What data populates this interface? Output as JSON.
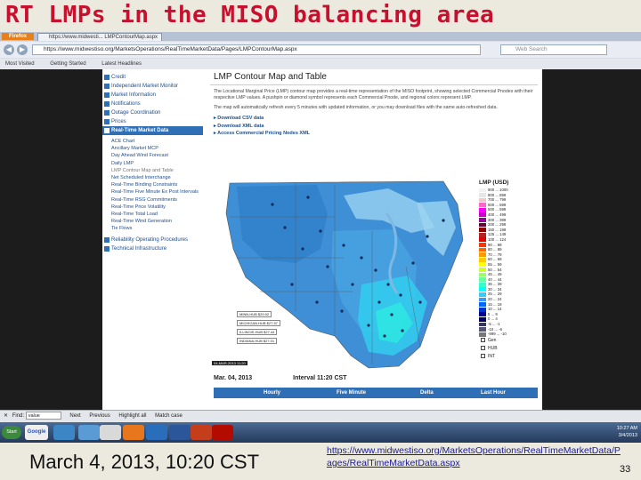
{
  "slide": {
    "title": "RT LMPs in the MISO balancing area",
    "caption": "March 4, 2013, 10:20 CST",
    "source_url": "https://www.midwestiso.org/MarketsOperations/RealTimeMarketData/Pages/RealTimeMarketData.aspx",
    "page_number": "33"
  },
  "browser": {
    "app_button": "Firefox",
    "tab_title": "https://www.midwesti... LMPContourMap.aspx",
    "url": "https://www.midwestiso.org/MarketsOperations/RealTimeMarketData/Pages/LMPContourMap.aspx",
    "search_placeholder": "Web Search",
    "bookmarks": [
      "Most Visited",
      "Getting Started",
      "Latest Headlines"
    ]
  },
  "leftnav": {
    "items": [
      {
        "label": "Credit"
      },
      {
        "label": "Independent Market Monitor"
      },
      {
        "label": "Market Information"
      },
      {
        "label": "Notifications"
      },
      {
        "label": "Outage Coordination"
      },
      {
        "label": "Prices"
      },
      {
        "label": "Real-Time Market Data",
        "active": true
      }
    ],
    "subitems": [
      "ACE Chart",
      "Ancillary Market MCP",
      "Day Ahead Wind Forecast",
      "Daily LMP",
      "LMP Contour Map and Table",
      "Net Scheduled Interchange",
      "Real-Time Binding Constraints",
      "Real-Time Five Minute Ex Post Intervals",
      "Real-Time RSG Commitments",
      "Real-Time Price Volatility",
      "Real-Time Total Load",
      "Real-Time Wind Generation",
      "Tie Flows"
    ],
    "bottom_items": [
      {
        "label": "Reliability Operating Procedures"
      },
      {
        "label": "Technical Infrastructure"
      }
    ]
  },
  "content": {
    "title": "LMP Contour Map and Table",
    "desc1": "The Locational Marginal Price (LMP) contour map provides a real-time representation of the MISO footprint, showing selected Commercial Pnodes with their respective LMP values. A pushpin or diamond symbol represents each Commercial Pnode, and regional colors represent LMP.",
    "desc2": "The map will automatically refresh every 5 minutes with updated information, or you may download files with the same auto-refreshed data.",
    "links": [
      "Download CSV data",
      "Download XML data",
      "Access Commercial Pricing Nodes XML"
    ],
    "map_stamp": "04-MAR-2013 11:20",
    "hub_labels": [
      "MINN.HUB $29.92",
      "MICHIGAN.HUB $27.57",
      "ILLINOIS.HUB $27.44",
      "INDIANA.HUB $27.01"
    ],
    "date_text": "Mar. 04, 2013",
    "interval_text": "Interval 11:20 CST",
    "table_headers": [
      "Hourly",
      "Five Minute",
      "Delta",
      "Last Hour"
    ]
  },
  "legend": {
    "title": "LMP (USD)",
    "rows": [
      {
        "label": "900 ... 1000",
        "color": "#f2f2f2"
      },
      {
        "label": "800 ... 899",
        "color": "#e6e6e6"
      },
      {
        "label": "700 ... 799",
        "color": "#f0c8c8"
      },
      {
        "label": "600 ... 699",
        "color": "#ff66cc"
      },
      {
        "label": "500 ... 599",
        "color": "#ff00ff"
      },
      {
        "label": "400 ... 499",
        "color": "#cc00cc"
      },
      {
        "label": "300 ... 399",
        "color": "#990099"
      },
      {
        "label": "200 ... 299",
        "color": "#660033"
      },
      {
        "label": "150 ... 199",
        "color": "#8b0000"
      },
      {
        "label": "125 ... 149",
        "color": "#b22222"
      },
      {
        "label": "100 ... 124",
        "color": "#e60000"
      },
      {
        "label": "90 ... 99",
        "color": "#ff3300"
      },
      {
        "label": "80 ... 89",
        "color": "#ff6600"
      },
      {
        "label": "70 ... 79",
        "color": "#ff9900"
      },
      {
        "label": "60 ... 69",
        "color": "#ffcc00"
      },
      {
        "label": "55 ... 59",
        "color": "#ffff00"
      },
      {
        "label": "50 ... 54",
        "color": "#ccff33"
      },
      {
        "label": "45 ... 49",
        "color": "#99ff66"
      },
      {
        "label": "40 ... 44",
        "color": "#66ff99"
      },
      {
        "label": "35 ... 39",
        "color": "#33ffcc"
      },
      {
        "label": "30 ... 34",
        "color": "#00ffff"
      },
      {
        "label": "25 ... 29",
        "color": "#33ccff"
      },
      {
        "label": "20 ... 24",
        "color": "#3399ff"
      },
      {
        "label": "15 ... 19",
        "color": "#0066ff"
      },
      {
        "label": "10 ... 14",
        "color": "#0033cc"
      },
      {
        "label": "5 ... 9",
        "color": "#000099"
      },
      {
        "label": "0 ... 4",
        "color": "#000066"
      },
      {
        "label": "-5 ... -1",
        "color": "#333366"
      },
      {
        "label": "-10 ... -6",
        "color": "#555577"
      },
      {
        "label": "-999 ... -10",
        "color": "#777777"
      }
    ],
    "checks": [
      "Gen",
      "HUB",
      "INT"
    ]
  },
  "findbar": {
    "label": "Find:",
    "value": "value",
    "next": "Next",
    "previous": "Previous",
    "highlight": "Highlight all",
    "match_case": "Match case"
  },
  "taskbar": {
    "start": "Start",
    "google": "Google",
    "time": "10:27 AM",
    "date": "3/4/2013"
  }
}
